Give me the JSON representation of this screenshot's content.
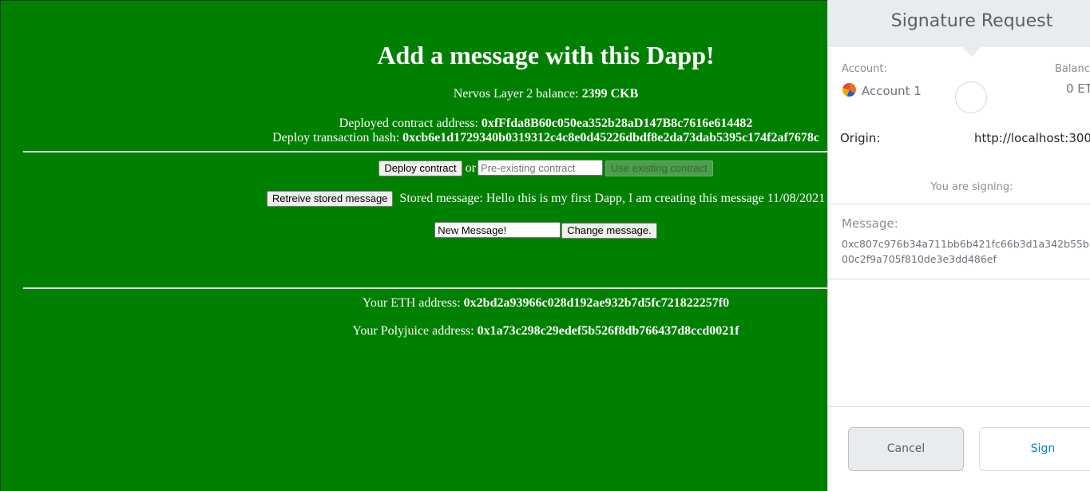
{
  "dapp": {
    "title": "Add a message with this Dapp!",
    "balance_label": "Nervos Layer 2 balance:",
    "balance_value": "2399 CKB",
    "contract_label": "Deployed contract address:",
    "contract_value": "0xfFfda8B60c050ea352b28aD147B8c7616e614482",
    "tx_label": "Deploy transaction hash:",
    "tx_value": "0xcb6e1d1729340b0319312c4c8e0d45226dbdf8e2da73dab5395c174f2af7678c",
    "deploy_button": "Deploy contract",
    "or_text": "or",
    "existing_placeholder": "Pre-existing contract",
    "use_existing_button": "Use existing contract",
    "retrieve_button": "Retreive stored message",
    "stored_message": "Stored message: Hello this is my first Dapp, I am creating this message 11/08/2021",
    "new_message_value": "New Message!",
    "change_button": "Change message.",
    "eth_label": "Your ETH address:",
    "eth_value": "0x2bd2a93966c028d192ae932b7d5fc721822257f0",
    "polyjuice_label": "Your Polyjuice address:",
    "polyjuice_value": "0x1a73c298c29edef5b526f8db766437d8ccd0021f"
  },
  "metamask": {
    "title": "Signature Request",
    "account_label": "Account:",
    "account_name": "Account 1",
    "balance_label": "Balanc",
    "balance_value": "0 ET",
    "origin_label": "Origin:",
    "origin_value": "http://localhost:300",
    "signing_text": "You are signing:",
    "message_label": "Message:",
    "message_line1": "0xc807c976b34a711bb6b421fc66b3d1a342b55b",
    "message_line2": "00c2f9a705f810de3e3dd486ef",
    "cancel_button": "Cancel",
    "sign_button": "Sign"
  },
  "colors": {
    "page_background": "#008000",
    "sign_accent": "#037dd6"
  }
}
